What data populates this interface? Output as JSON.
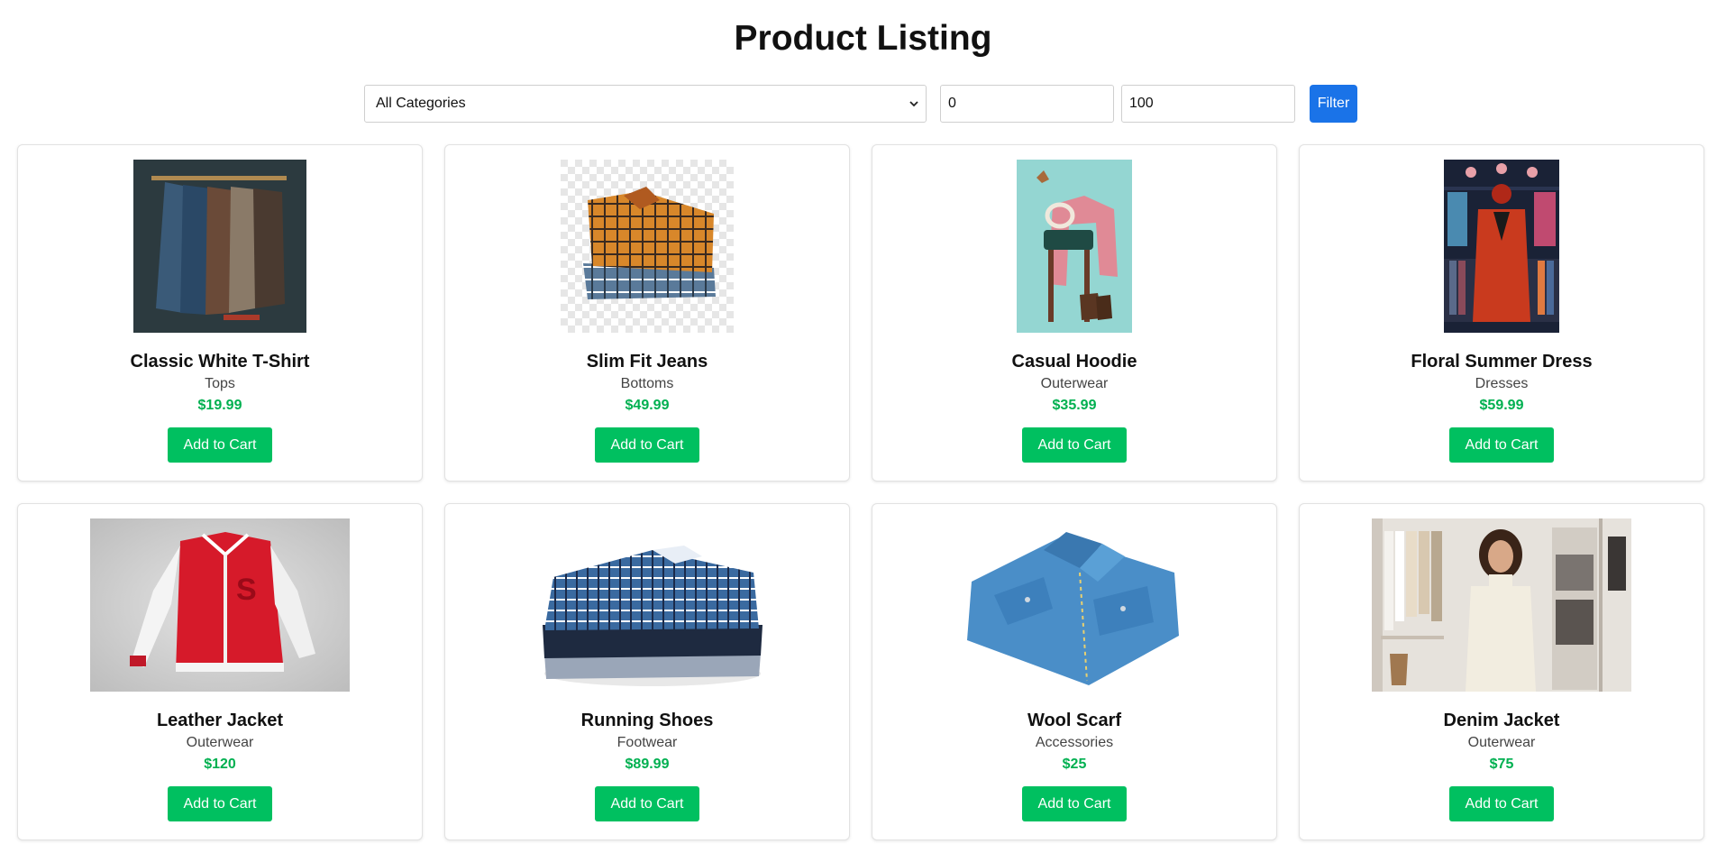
{
  "page": {
    "title": "Product Listing"
  },
  "filters": {
    "category_selected": "All Categories",
    "min_price": "0",
    "max_price": "100",
    "filter_label": "Filter"
  },
  "colors": {
    "accent_blue": "#1a73e8",
    "cart_green": "#00c060",
    "price_green": "#00b050"
  },
  "products": [
    {
      "name": "Classic White T-Shirt",
      "category": "Tops",
      "price": "$19.99",
      "cart_label": "Add to Cart"
    },
    {
      "name": "Slim Fit Jeans",
      "category": "Bottoms",
      "price": "$49.99",
      "cart_label": "Add to Cart"
    },
    {
      "name": "Casual Hoodie",
      "category": "Outerwear",
      "price": "$35.99",
      "cart_label": "Add to Cart"
    },
    {
      "name": "Floral Summer Dress",
      "category": "Dresses",
      "price": "$59.99",
      "cart_label": "Add to Cart"
    },
    {
      "name": "Leather Jacket",
      "category": "Outerwear",
      "price": "$120",
      "cart_label": "Add to Cart"
    },
    {
      "name": "Running Shoes",
      "category": "Footwear",
      "price": "$89.99",
      "cart_label": "Add to Cart"
    },
    {
      "name": "Wool Scarf",
      "category": "Accessories",
      "price": "$25",
      "cart_label": "Add to Cart"
    },
    {
      "name": "Denim Jacket",
      "category": "Outerwear",
      "price": "$75",
      "cart_label": "Add to Cart"
    }
  ]
}
